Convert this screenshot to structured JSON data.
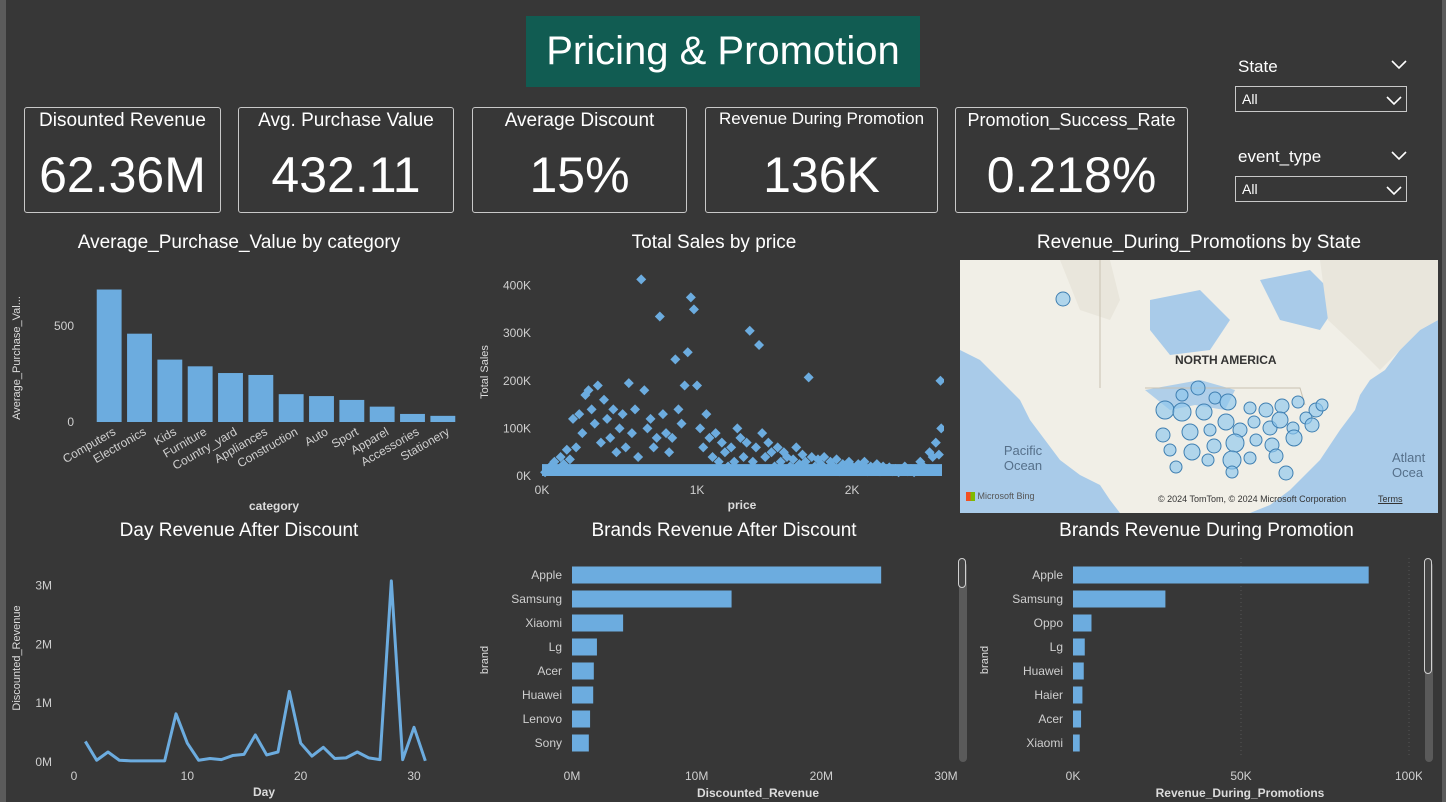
{
  "header": {
    "title": "Pricing & Promotion"
  },
  "kpis": [
    {
      "label": "Disounted Revenue",
      "value": "62.36M"
    },
    {
      "label": "Avg. Purchase Value",
      "value": "432.11"
    },
    {
      "label": "Average Discount",
      "value": "15%"
    },
    {
      "label": "Revenue During Promotion",
      "value": "136K"
    },
    {
      "label": "Promotion_Success_Rate",
      "value": "0.218%"
    }
  ],
  "slicers": {
    "state": {
      "label": "State",
      "value": "All"
    },
    "event_type": {
      "label": "event_type",
      "value": "All"
    }
  },
  "visuals": {
    "avg_purchase": {
      "title": "Average_Purchase_Value by category"
    },
    "sales_price": {
      "title": "Total Sales by price"
    },
    "map": {
      "title": "Revenue_During_Promotions by State",
      "continent_label": "NORTH AMERICA",
      "ocean_left": "Pacific Ocean",
      "ocean_right": "Atlant Ocea",
      "logo": "Microsoft Bing",
      "copyright": "© 2024 TomTom, © 2024 Microsoft Corporation",
      "terms": "Terms"
    },
    "day_revenue": {
      "title": "Day Revenue After Discount"
    },
    "brands_discount": {
      "title": "Brands Revenue After Discount"
    },
    "brands_promo": {
      "title": "Brands Revenue During Promotion"
    }
  },
  "colors": {
    "bar": "#6cacdf",
    "title_bg": "#115c52",
    "background": "#373737",
    "kpi_border": "#c8c8c8"
  },
  "chart_data": [
    {
      "type": "bar",
      "title": "Average_Purchase_Value by category",
      "xlabel": "category",
      "ylabel": "Average_Purchase_Val...",
      "categories": [
        "Computers",
        "Electronics",
        "Kids",
        "Furniture",
        "Country_yard",
        "Appliances",
        "Construction",
        "Auto",
        "Sport",
        "Apparel",
        "Accessories",
        "Stationery"
      ],
      "values": [
        690,
        460,
        325,
        290,
        255,
        245,
        145,
        135,
        115,
        80,
        42,
        32
      ],
      "yticks": [
        {
          "v": 0,
          "label": "0"
        },
        {
          "v": 500,
          "label": "500"
        }
      ],
      "ylim": [
        0,
        750
      ]
    },
    {
      "type": "scatter",
      "title": "Total Sales by price",
      "xlabel": "price",
      "ylabel": "Total Sales",
      "xlim": [
        0,
        2580
      ],
      "ylim": [
        0,
        420000
      ],
      "xticks": [
        {
          "v": 0,
          "label": "0K"
        },
        {
          "v": 1000,
          "label": "1K"
        },
        {
          "v": 2000,
          "label": "2K"
        }
      ],
      "yticks": [
        {
          "v": 0,
          "label": "0K"
        },
        {
          "v": 100000,
          "label": "100K"
        },
        {
          "v": 200000,
          "label": "200K"
        },
        {
          "v": 300000,
          "label": "300K"
        },
        {
          "v": 400000,
          "label": "400K"
        }
      ],
      "points": [
        [
          20,
          8000
        ],
        [
          40,
          15000
        ],
        [
          60,
          22000
        ],
        [
          80,
          30000
        ],
        [
          100,
          12000
        ],
        [
          120,
          40000
        ],
        [
          140,
          25000
        ],
        [
          160,
          55000
        ],
        [
          180,
          35000
        ],
        [
          200,
          120000
        ],
        [
          220,
          60000
        ],
        [
          240,
          130000
        ],
        [
          260,
          90000
        ],
        [
          280,
          170000
        ],
        [
          300,
          180000
        ],
        [
          320,
          140000
        ],
        [
          340,
          110000
        ],
        [
          360,
          190000
        ],
        [
          380,
          70000
        ],
        [
          400,
          160000
        ],
        [
          420,
          120000
        ],
        [
          440,
          80000
        ],
        [
          460,
          140000
        ],
        [
          480,
          50000
        ],
        [
          500,
          100000
        ],
        [
          520,
          130000
        ],
        [
          540,
          60000
        ],
        [
          560,
          195000
        ],
        [
          580,
          90000
        ],
        [
          600,
          140000
        ],
        [
          620,
          40000
        ],
        [
          640,
          413000
        ],
        [
          660,
          180000
        ],
        [
          680,
          100000
        ],
        [
          700,
          120000
        ],
        [
          720,
          60000
        ],
        [
          740,
          80000
        ],
        [
          760,
          335000
        ],
        [
          780,
          130000
        ],
        [
          800,
          90000
        ],
        [
          820,
          50000
        ],
        [
          840,
          80000
        ],
        [
          860,
          245000
        ],
        [
          880,
          140000
        ],
        [
          900,
          110000
        ],
        [
          920,
          190000
        ],
        [
          940,
          260000
        ],
        [
          960,
          375000
        ],
        [
          980,
          350000
        ],
        [
          1000,
          190000
        ],
        [
          1020,
          100000
        ],
        [
          1040,
          60000
        ],
        [
          1060,
          130000
        ],
        [
          1080,
          80000
        ],
        [
          1100,
          40000
        ],
        [
          1120,
          90000
        ],
        [
          1140,
          30000
        ],
        [
          1160,
          70000
        ],
        [
          1180,
          50000
        ],
        [
          1200,
          20000
        ],
        [
          1220,
          60000
        ],
        [
          1240,
          30000
        ],
        [
          1260,
          100000
        ],
        [
          1280,
          80000
        ],
        [
          1300,
          40000
        ],
        [
          1320,
          70000
        ],
        [
          1340,
          305000
        ],
        [
          1360,
          30000
        ],
        [
          1380,
          60000
        ],
        [
          1400,
          275000
        ],
        [
          1420,
          90000
        ],
        [
          1440,
          40000
        ],
        [
          1460,
          70000
        ],
        [
          1480,
          50000
        ],
        [
          1500,
          20000
        ],
        [
          1520,
          60000
        ],
        [
          1540,
          30000
        ],
        [
          1560,
          50000
        ],
        [
          1580,
          40000
        ],
        [
          1600,
          20000
        ],
        [
          1620,
          35000
        ],
        [
          1640,
          60000
        ],
        [
          1660,
          25000
        ],
        [
          1680,
          45000
        ],
        [
          1700,
          30000
        ],
        [
          1720,
          207000
        ],
        [
          1740,
          40000
        ],
        [
          1760,
          20000
        ],
        [
          1780,
          35000
        ],
        [
          1800,
          25000
        ],
        [
          1820,
          40000
        ],
        [
          1840,
          15000
        ],
        [
          1860,
          30000
        ],
        [
          1880,
          20000
        ],
        [
          1900,
          35000
        ],
        [
          1920,
          10000
        ],
        [
          1940,
          25000
        ],
        [
          1960,
          15000
        ],
        [
          1980,
          30000
        ],
        [
          2000,
          20000
        ],
        [
          2020,
          12000
        ],
        [
          2040,
          25000
        ],
        [
          2060,
          15000
        ],
        [
          2080,
          30000
        ],
        [
          2100,
          10000
        ],
        [
          2120,
          20000
        ],
        [
          2140,
          12000
        ],
        [
          2160,
          25000
        ],
        [
          2180,
          10000
        ],
        [
          2200,
          20000
        ],
        [
          2220,
          12000
        ],
        [
          2240,
          18000
        ],
        [
          2260,
          10000
        ],
        [
          2280,
          15000
        ],
        [
          2300,
          8000
        ],
        [
          2320,
          12000
        ],
        [
          2340,
          20000
        ],
        [
          2360,
          10000
        ],
        [
          2380,
          15000
        ],
        [
          2400,
          8000
        ],
        [
          2420,
          12000
        ],
        [
          2440,
          30000
        ],
        [
          2460,
          20000
        ],
        [
          2480,
          15000
        ],
        [
          2500,
          50000
        ],
        [
          2520,
          40000
        ],
        [
          2540,
          70000
        ],
        [
          2560,
          45000
        ],
        [
          2570,
          200000
        ],
        [
          2575,
          100000
        ]
      ]
    },
    {
      "type": "line",
      "title": "Day Revenue After Discount",
      "xlabel": "Day",
      "ylabel": "Discounted_Revenue",
      "xlim": [
        0,
        33
      ],
      "ylim": [
        0,
        3300000
      ],
      "xticks": [
        {
          "v": 0,
          "label": "0"
        },
        {
          "v": 10,
          "label": "10"
        },
        {
          "v": 20,
          "label": "20"
        },
        {
          "v": 30,
          "label": "30"
        }
      ],
      "yticks": [
        {
          "v": 0,
          "label": "0M"
        },
        {
          "v": 1000000,
          "label": "1M"
        },
        {
          "v": 2000000,
          "label": "2M"
        },
        {
          "v": 3000000,
          "label": "3M"
        }
      ],
      "x": [
        1,
        2,
        3,
        4,
        5,
        6,
        7,
        8,
        9,
        10,
        11,
        12,
        13,
        14,
        15,
        16,
        17,
        18,
        19,
        20,
        21,
        22,
        23,
        24,
        25,
        26,
        27,
        28,
        29,
        30,
        31
      ],
      "values": [
        350000,
        30000,
        170000,
        30000,
        20000,
        20000,
        20000,
        20000,
        820000,
        320000,
        30000,
        60000,
        40000,
        110000,
        130000,
        460000,
        120000,
        170000,
        1200000,
        320000,
        100000,
        250000,
        60000,
        70000,
        170000,
        70000,
        40000,
        3080000,
        40000,
        590000,
        20000
      ]
    },
    {
      "type": "bar",
      "title": "Brands Revenue After Discount",
      "xlabel": "Discounted_Revenue",
      "ylabel": "brand",
      "categories": [
        "Apple",
        "Samsung",
        "Xiaomi",
        "Lg",
        "Acer",
        "Huawei",
        "Lenovo",
        "Sony"
      ],
      "values": [
        24800000,
        12800000,
        4100000,
        2000000,
        1750000,
        1700000,
        1450000,
        1350000
      ],
      "xlim": [
        0,
        30000000
      ],
      "xticks": [
        {
          "v": 0,
          "label": "0M"
        },
        {
          "v": 10000000,
          "label": "10M"
        },
        {
          "v": 20000000,
          "label": "20M"
        },
        {
          "v": 30000000,
          "label": "30M"
        }
      ]
    },
    {
      "type": "bar",
      "title": "Brands Revenue During Promotion",
      "xlabel": "Revenue_During_Promotions",
      "ylabel": "brand",
      "categories": [
        "Apple",
        "Samsung",
        "Oppo",
        "Lg",
        "Huawei",
        "Haier",
        "Acer",
        "Xiaomi"
      ],
      "values": [
        88000,
        27500,
        5500,
        3500,
        3200,
        2800,
        2400,
        2000
      ],
      "xlim": [
        0,
        100000
      ],
      "xticks": [
        {
          "v": 0,
          "label": "0K"
        },
        {
          "v": 50000,
          "label": "50K"
        },
        {
          "v": 100000,
          "label": "100K"
        }
      ]
    }
  ]
}
